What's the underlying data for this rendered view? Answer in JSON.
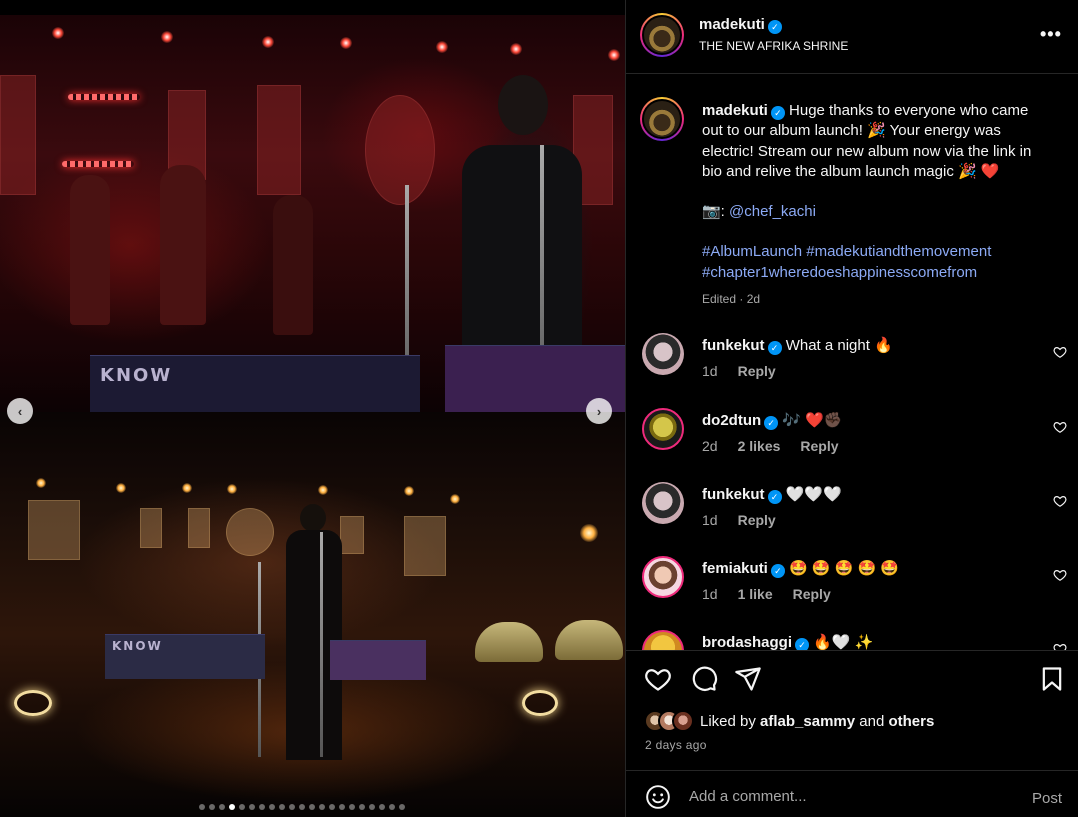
{
  "post": {
    "header": {
      "username": "madekuti",
      "location": "THE NEW AFRIKA SHRINE",
      "more_label": "•••"
    },
    "caption": {
      "username": "madekuti",
      "text_1": "Huge thanks to everyone who came out to our album launch! 🎉 Your energy was electric! Stream our new album now via the link in bio and relive the album launch magic 🎉 ",
      "text_heart": "❤️",
      "credit_prefix": "📷: ",
      "credit_handle": "@chef_kachi",
      "hashtag_1": "#AlbumLaunch",
      "hashtag_2": "#madekutiandthemovement",
      "hashtag_3": "#chapter1wheredoeshappinesscomefrom",
      "meta": "Edited · 2d"
    },
    "comments": [
      {
        "username": "funkekut",
        "text": "What a night 🔥",
        "time": "1d",
        "likes": "",
        "reply": "Reply"
      },
      {
        "username": "do2dtun",
        "text": "🎶 ❤️✊🏿",
        "time": "2d",
        "likes": "2 likes",
        "reply": "Reply"
      },
      {
        "username": "funkekut",
        "text": "🤍🤍🤍",
        "time": "1d",
        "likes": "",
        "reply": "Reply"
      },
      {
        "username": "femiakuti",
        "text": "🤩 🤩 🤩 🤩 🤩",
        "time": "1d",
        "likes": "1 like",
        "reply": "Reply"
      },
      {
        "username": "brodashaggi",
        "text": "🔥🤍 ✨",
        "time": "",
        "likes": "",
        "reply": ""
      }
    ],
    "likes": {
      "prefix": "Liked by ",
      "user": "aflab_sammy",
      "middle": " and ",
      "others": "others"
    },
    "time_ago": "2 days ago",
    "comment_input": {
      "placeholder": "Add a comment...",
      "post_label": "Post"
    },
    "carousel": {
      "current_index": 3,
      "total": 21,
      "prev_label": "‹",
      "next_label": "›"
    },
    "banner_text_top": "KNOW",
    "banner_text_bottom": "KNOW"
  },
  "icons": [
    "heart-icon",
    "comment-icon",
    "share-icon",
    "save-icon",
    "smiley-icon",
    "verified-icon",
    "more-icon",
    "chevron-left-icon",
    "chevron-right-icon"
  ],
  "colors": {
    "background": "#000000",
    "text": "#f5f5f5",
    "muted": "#a8a8a8",
    "link": "#8caaf5",
    "verified": "#0095f6",
    "divider": "#262626"
  }
}
